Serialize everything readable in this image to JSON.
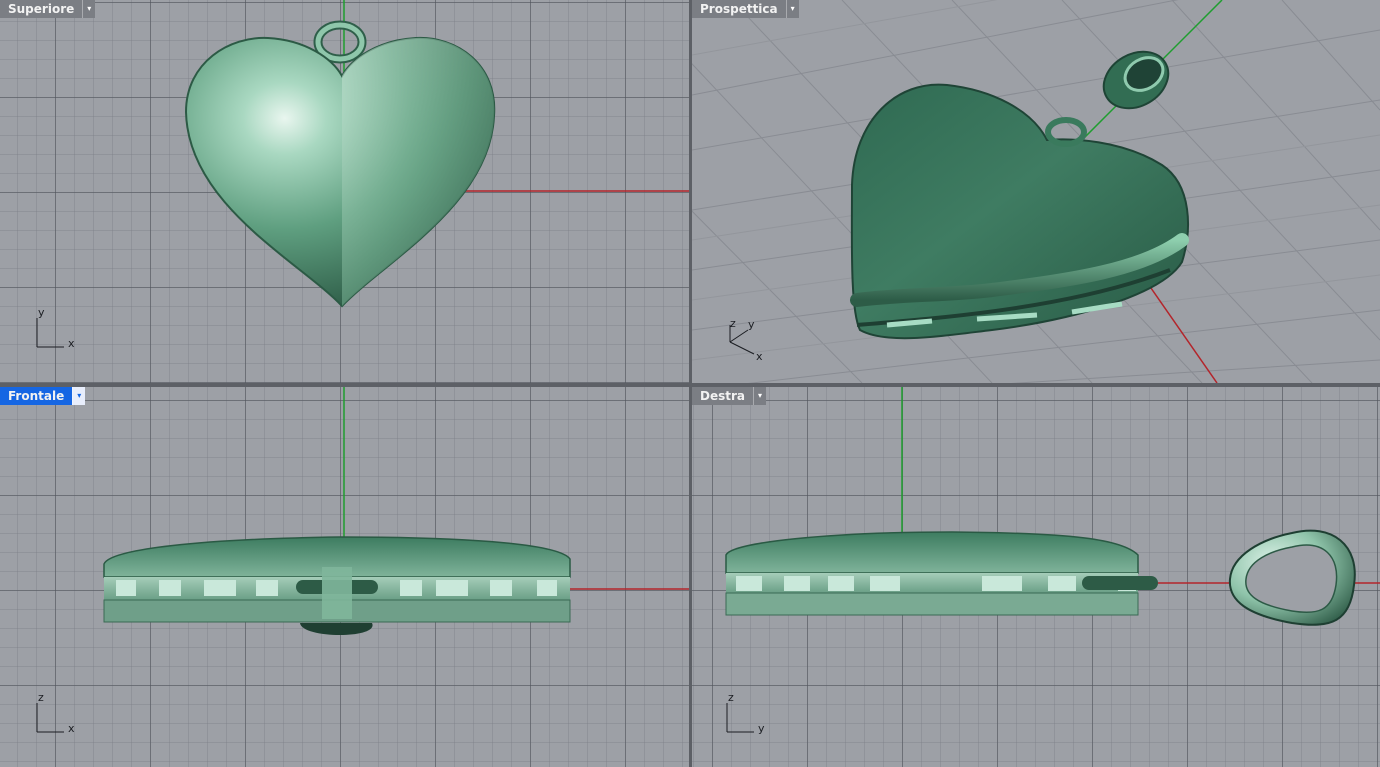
{
  "viewports": {
    "top": {
      "label": "Superiore",
      "active": false,
      "axes": {
        "horizontal": "x",
        "vertical": "y"
      }
    },
    "persp": {
      "label": "Prospettica",
      "active": false,
      "axes": {
        "a": "z",
        "b": "y",
        "c": "x"
      }
    },
    "front": {
      "label": "Frontale",
      "active": true,
      "axes": {
        "horizontal": "x",
        "vertical": "z"
      }
    },
    "right": {
      "label": "Destra",
      "active": false,
      "axes": {
        "horizontal": "y",
        "vertical": "z"
      }
    }
  },
  "menu_arrow": "▾",
  "colors": {
    "grid_background": "#9da0a6",
    "x_axis": "#b3252b",
    "y_axis": "#1f9e2f",
    "model": "#3f8062",
    "active_tab": "#1566e3"
  },
  "icons": {
    "dropdown": "chevron-down-icon"
  }
}
